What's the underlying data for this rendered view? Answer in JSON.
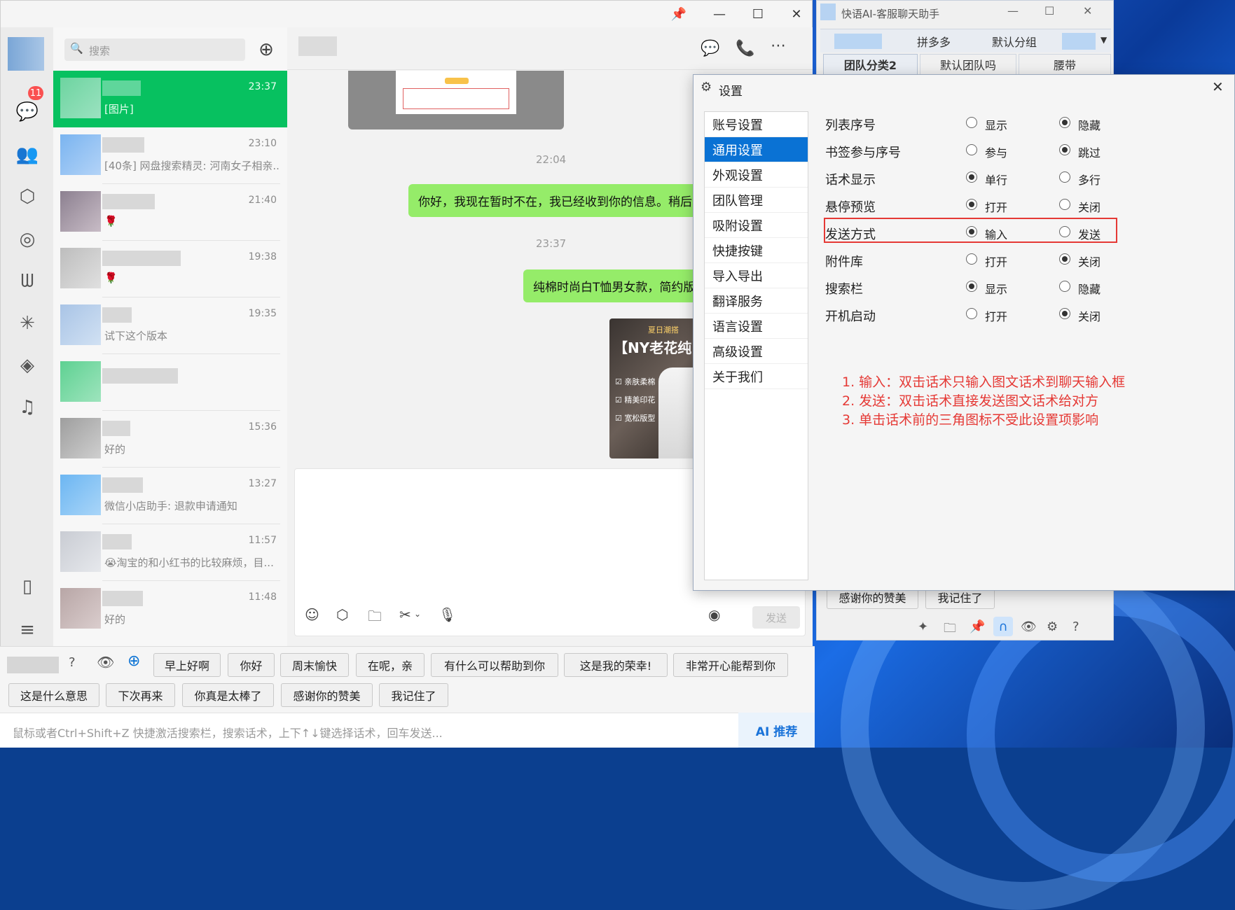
{
  "wechat": {
    "search_placeholder": "搜索",
    "unread_badge": "11",
    "conversations": [
      {
        "time": "23:37",
        "msg": "[图片]"
      },
      {
        "time": "23:10",
        "msg": "[40条] 网盘搜索精灵: 河南女子相亲..."
      },
      {
        "time": "21:40",
        "msg": "🌹"
      },
      {
        "time": "19:38",
        "msg": "🌹"
      },
      {
        "time": "19:35",
        "msg": "试下这个版本"
      },
      {
        "time": "",
        "msg": ""
      },
      {
        "time": "15:36",
        "msg": "好的"
      },
      {
        "time": "13:27",
        "msg": "微信小店助手: 退款申请通知"
      },
      {
        "time": "11:57",
        "msg": "😭淘宝的和小红书的比较麻烦，目..."
      },
      {
        "time": "11:48",
        "msg": "好的"
      }
    ],
    "chat": {
      "time1": "22:04",
      "bubble1": "你好，我现在暂时不在，我已经收到你的信息。稍后",
      "time2": "23:37",
      "bubble2": "纯棉时尚白T恤男女款，简约版",
      "image_text": "【NY老花纯",
      "image_tag": "夏日潮搭",
      "image_checks": [
        "亲肤柔棉",
        "精美印花",
        "宽松版型"
      ],
      "send_label": "发送"
    }
  },
  "quickbar": {
    "row1": [
      "早上好啊",
      "你好",
      "周末愉快",
      "在呢，亲",
      "有什么可以帮助到你",
      "这是我的荣幸!",
      "非常开心能帮到你"
    ],
    "row2": [
      "这是什么意思",
      "下次再来",
      "你真是太棒了",
      "感谢你的赞美",
      "我记住了"
    ],
    "input_placeholder": "鼠标或者Ctrl+Shift+Z 快捷激活搜索栏，搜索话术，上下↑↓键选择话术，回车发送...",
    "ai_label": "AI 推荐"
  },
  "helper": {
    "title": "快语AI-客服聊天助手",
    "tabs_row1": [
      "拼多多",
      "默认分组"
    ],
    "tabs_row2": [
      "团队分类2",
      "默认团队吗",
      "腰带"
    ],
    "bottom_buttons": [
      "感谢你的赞美",
      "我记住了"
    ]
  },
  "settings": {
    "title": "设置",
    "menu": [
      "账号设置",
      "通用设置",
      "外观设置",
      "团队管理",
      "吸附设置",
      "快捷按键",
      "导入导出",
      "翻译服务",
      "语言设置",
      "高级设置",
      "关于我们"
    ],
    "selected_menu": "通用设置",
    "options": [
      {
        "label": "列表序号",
        "a": "显示",
        "b": "隐藏",
        "selected": "b"
      },
      {
        "label": "书签参与序号",
        "a": "参与",
        "b": "跳过",
        "selected": "b"
      },
      {
        "label": "话术显示",
        "a": "单行",
        "b": "多行",
        "selected": "a"
      },
      {
        "label": "悬停预览",
        "a": "打开",
        "b": "关闭",
        "selected": "a"
      },
      {
        "label": "发送方式",
        "a": "输入",
        "b": "发送",
        "selected": "a"
      },
      {
        "label": "附件库",
        "a": "打开",
        "b": "关闭",
        "selected": "b"
      },
      {
        "label": "搜索栏",
        "a": "显示",
        "b": "隐藏",
        "selected": "a"
      },
      {
        "label": "开机启动",
        "a": "打开",
        "b": "关闭",
        "selected": "b"
      }
    ],
    "notes": [
      "1. 输入：双击话术只输入图文话术到聊天输入框",
      "2. 发送：双击话术直接发送图文话术给对方",
      "3. 单击话术前的三角图标不受此设置项影响"
    ],
    "highlight_color": "#e53935",
    "accent_color": "#0a72d4"
  }
}
